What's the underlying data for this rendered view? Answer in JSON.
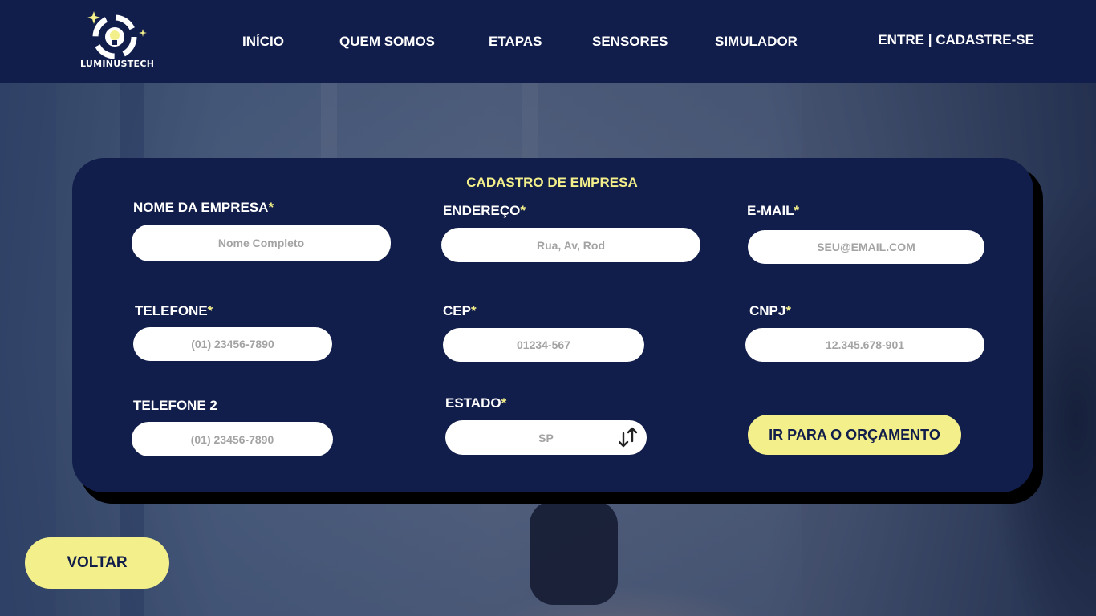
{
  "brand": {
    "name": "LUMINUSTECH",
    "logo_icon": "lightbulb-swirl-logo",
    "accent": "#f3ef8a",
    "primary": "#111d4a"
  },
  "nav": {
    "items": [
      "INÍCIO",
      "QUEM SOMOS",
      "ETAPAS",
      "SENSORES",
      "SIMULADOR"
    ],
    "login": "ENTRE",
    "separator": "|",
    "signup": "CADASTRE-SE"
  },
  "form": {
    "title": "CADASTRO DE EMPRESA",
    "required_mark": "*",
    "fields": {
      "company_name": {
        "label": "NOME DA EMPRESA",
        "placeholder": "Nome Completo"
      },
      "address": {
        "label": "ENDEREÇO",
        "placeholder": "Rua, Av, Rod"
      },
      "email": {
        "label": "E-MAIL",
        "placeholder": "SEU@EMAIL.COM"
      },
      "phone": {
        "label": "TELEFONE",
        "placeholder": "(01) 23456-7890"
      },
      "cep": {
        "label": "CEP",
        "placeholder": "01234-567"
      },
      "cnpj": {
        "label": "CNPJ",
        "placeholder": "12.345.678-901"
      },
      "phone2": {
        "label": "TELEFONE 2",
        "placeholder": "(01) 23456-7890"
      },
      "state": {
        "label": "ESTADO",
        "value": "SP",
        "icon": "sort-arrows-icon"
      }
    },
    "submit_label": "IR PARA O ORÇAMENTO"
  },
  "back_label": "VOLTAR"
}
